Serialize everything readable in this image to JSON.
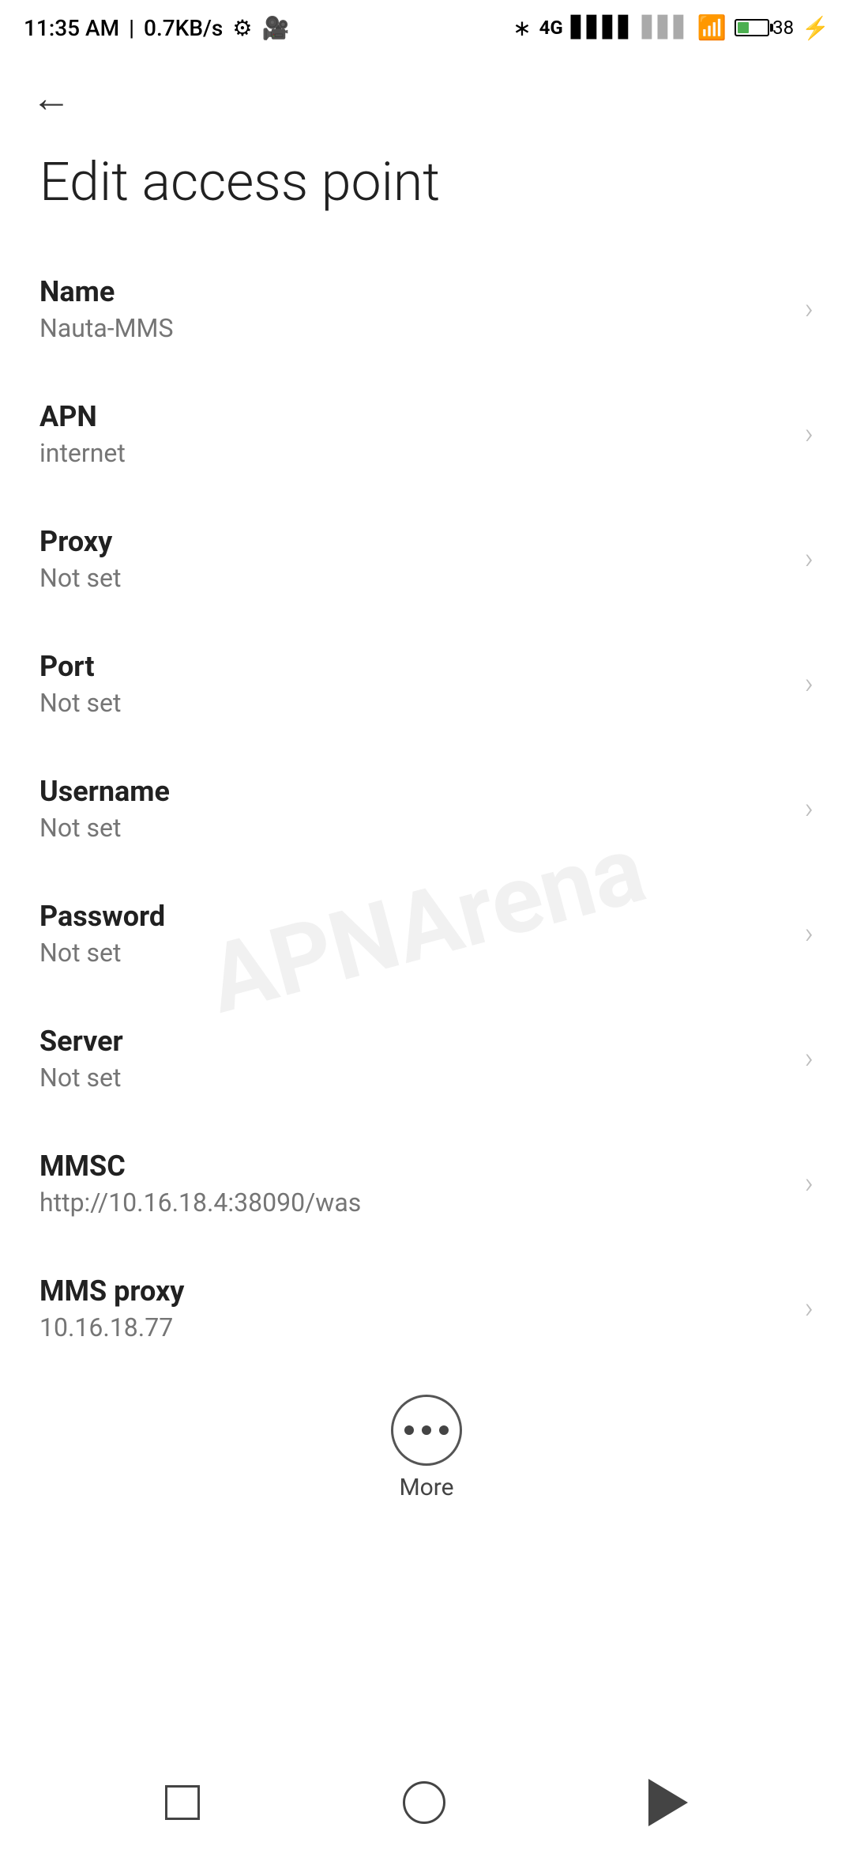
{
  "statusBar": {
    "time": "11:35 AM",
    "speed": "0.7KB/s",
    "battery_pct": "38"
  },
  "header": {
    "back_label": "←"
  },
  "page": {
    "title": "Edit access point"
  },
  "settings": [
    {
      "label": "Name",
      "value": "Nauta-MMS"
    },
    {
      "label": "APN",
      "value": "internet"
    },
    {
      "label": "Proxy",
      "value": "Not set"
    },
    {
      "label": "Port",
      "value": "Not set"
    },
    {
      "label": "Username",
      "value": "Not set"
    },
    {
      "label": "Password",
      "value": "Not set"
    },
    {
      "label": "Server",
      "value": "Not set"
    },
    {
      "label": "MMSC",
      "value": "http://10.16.18.4:38090/was"
    },
    {
      "label": "MMS proxy",
      "value": "10.16.18.77"
    }
  ],
  "more": {
    "label": "More"
  },
  "watermark": {
    "line1": "APNArena"
  }
}
